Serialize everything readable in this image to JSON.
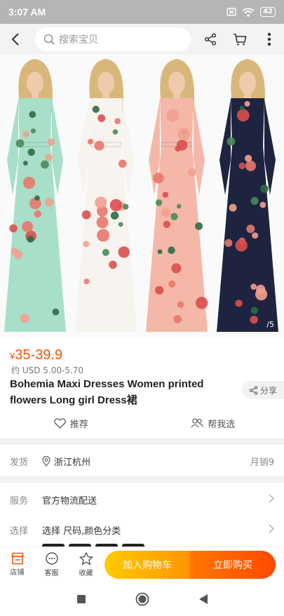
{
  "status_bar": {
    "time": "3:07 AM",
    "battery": "42"
  },
  "header": {
    "search_placeholder": "搜索宝贝"
  },
  "gallery": {
    "page_indicator": "/5",
    "dress_colors": [
      "#a8dfc8",
      "#f7f3ee",
      "#f5b8a8",
      "#1e2440"
    ]
  },
  "product": {
    "currency_symbol": "¥",
    "price": "35-39.9",
    "usd_price": "约 USD 5.00-5.70",
    "title": "Bohemia Maxi Dresses Women printed flowers Long girl Dress裙",
    "share_label": "分享",
    "recommend_label": "推荐",
    "help_choose_label": "帮我选"
  },
  "shipping": {
    "label": "发货",
    "location": "浙江杭州",
    "monthly_sales": "月销9"
  },
  "service": {
    "label": "服务",
    "value": "官方物流配送"
  },
  "select": {
    "label": "选择",
    "value": "选择 尺码,颜色分类"
  },
  "bottom_bar": {
    "store_label": "店铺",
    "service_label": "客服",
    "favorite_label": "收藏",
    "add_cart_label": "加入购物车",
    "buy_now_label": "立即购买"
  },
  "colors": {
    "accent": "#ff5000"
  }
}
